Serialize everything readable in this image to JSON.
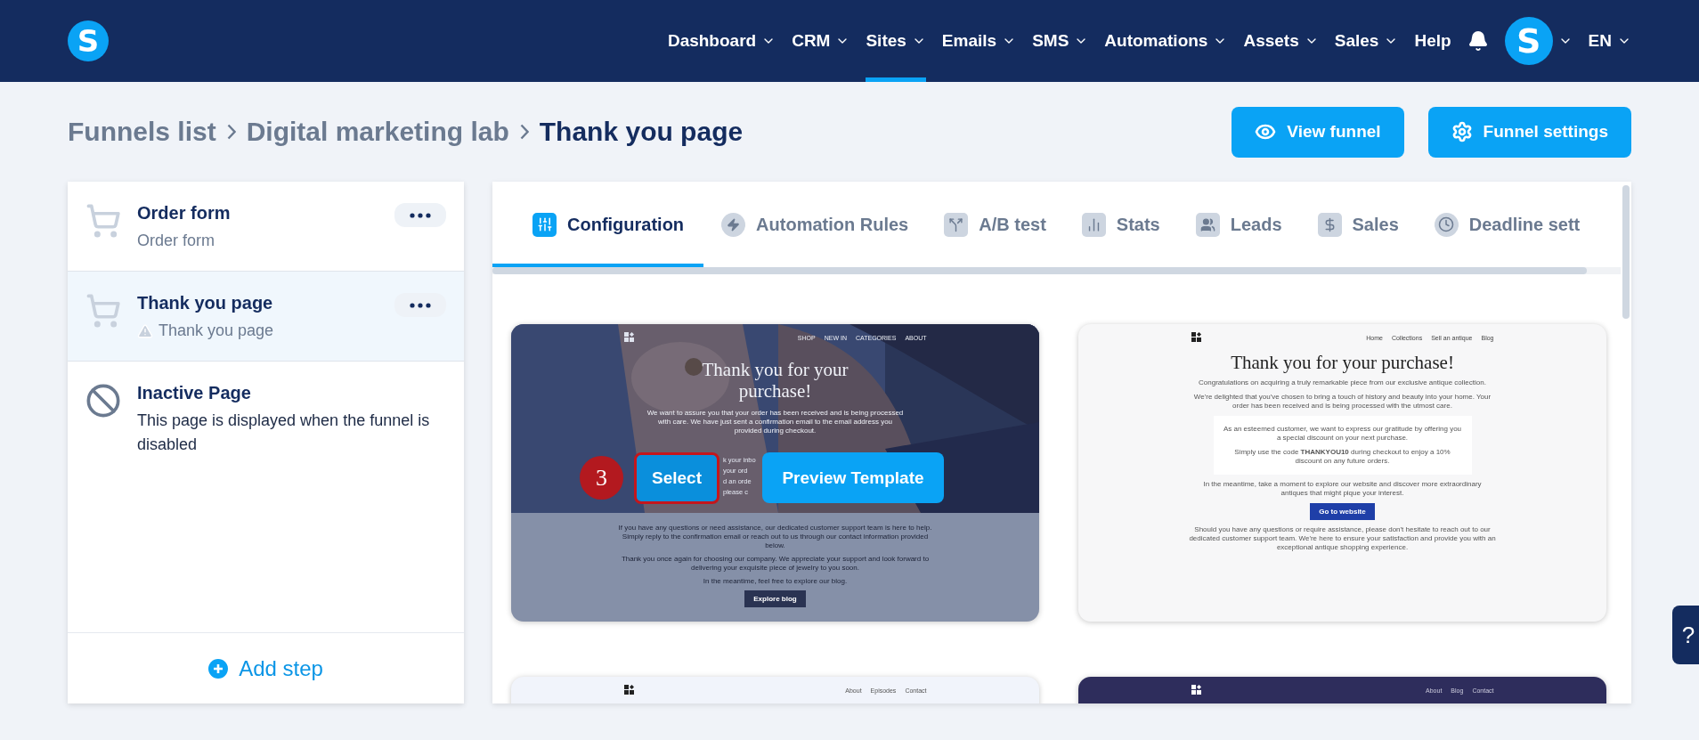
{
  "nav": {
    "logo": "S",
    "items": [
      {
        "label": "Dashboard",
        "selected": false,
        "dropdown": true
      },
      {
        "label": "CRM",
        "selected": false,
        "dropdown": true
      },
      {
        "label": "Sites",
        "selected": true,
        "dropdown": true
      },
      {
        "label": "Emails",
        "selected": false,
        "dropdown": true
      },
      {
        "label": "SMS",
        "selected": false,
        "dropdown": true
      },
      {
        "label": "Automations",
        "selected": false,
        "dropdown": true
      },
      {
        "label": "Assets",
        "selected": false,
        "dropdown": true
      },
      {
        "label": "Sales",
        "selected": false,
        "dropdown": true
      },
      {
        "label": "Help",
        "selected": false,
        "dropdown": false
      }
    ],
    "avatar": "S",
    "language": "EN"
  },
  "breadcrumb": [
    "Funnels list",
    "Digital marketing lab",
    "Thank you page"
  ],
  "actions": [
    {
      "label": "View funnel",
      "kind": "view"
    },
    {
      "label": "Funnel settings",
      "kind": "settings"
    }
  ],
  "steps": [
    {
      "title": "Order form",
      "subtitle": "Order form",
      "kind": "order",
      "selected": false,
      "warning": false
    },
    {
      "title": "Thank you page",
      "subtitle": "Thank you page",
      "kind": "thankyou",
      "selected": true,
      "warning": true
    },
    {
      "title": "Inactive Page",
      "subtitle": "This page is displayed when the funnel is disabled",
      "kind": "inactive",
      "selected": false,
      "warning": false
    }
  ],
  "add_step": "Add step",
  "tabs": [
    {
      "label": "Configuration",
      "kind": "config",
      "selected": true
    },
    {
      "label": "Automation Rules",
      "kind": "automation",
      "selected": false
    },
    {
      "label": "A/B test",
      "kind": "split",
      "selected": false
    },
    {
      "label": "Stats",
      "kind": "stats",
      "selected": false
    },
    {
      "label": "Leads",
      "kind": "leads",
      "selected": false
    },
    {
      "label": "Sales",
      "kind": "sales",
      "selected": false
    },
    {
      "label": "Deadline sett",
      "kind": "deadline",
      "selected": false
    }
  ],
  "templates": [
    {
      "hovered": true,
      "nav": [
        "SHOP",
        "NEW IN",
        "CATEGORIES",
        "ABOUT"
      ],
      "heading": "Thank you for your purchase!",
      "intro": "We want to assure you that your order has been received and is being processed with care. We have just sent a confirmation email to the email address you provided during checkout.",
      "peeking": [
        "k your inbo",
        "your ord",
        "d an orde",
        "please c"
      ],
      "paragraphs": [
        "If you have any questions or need assistance, our dedicated customer support team is here to help. Simply reply to the confirmation email or reach out to us through our contact information provided below.",
        "Thank you once again for choosing our company. We appreciate your support and look forward to delivering your exquisite piece of jewelry to you soon.",
        "In the meantime, feel free to explore our blog."
      ],
      "cta": "Explore blog",
      "select": "Select",
      "preview": "Preview Template",
      "marker": "3"
    },
    {
      "kind": "light",
      "hovered": false,
      "nav": [
        "Home",
        "Collections",
        "Sell an antique",
        "Blog"
      ],
      "heading": "Thank you for your purchase!",
      "paragraphs": [
        "Congratulations on acquiring a truly remarkable piece from our exclusive antique collection.",
        "We're delighted that you've chosen to bring a touch of history and beauty into your home. Your order has been received and is being processed with the utmost care."
      ],
      "box": [
        "As an esteemed customer, we want to express our gratitude by offering you a special discount on your next purchase.",
        "Simply use the code **THANKYOU10** during checkout to enjoy a 10% discount on any future orders."
      ],
      "after": "In the meantime, take a moment to explore our website and discover more extraordinary antiques that might pique your interest.",
      "cta": "Go to website",
      "closing": "Should you have any questions or require assistance, please don't hesitate to reach out to our dedicated customer support team. We're here to ensure your satisfaction and provide you with an exceptional antique shopping experience."
    },
    {
      "kind": "pale",
      "hovered": false,
      "nav": [
        "About",
        "Episodes",
        "Contact"
      ]
    },
    {
      "kind": "dark",
      "hovered": false,
      "nav": [
        "About",
        "Blog",
        "Contact"
      ]
    }
  ],
  "help": "?"
}
